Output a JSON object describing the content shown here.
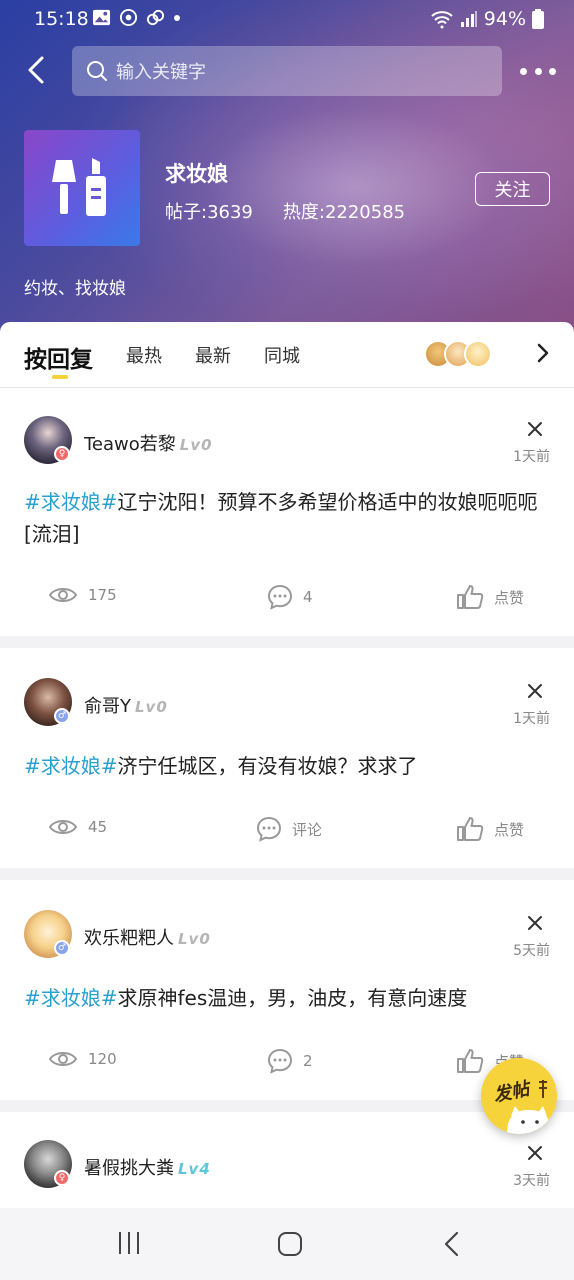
{
  "status_bar": {
    "time": "15:18",
    "battery": "94%"
  },
  "search": {
    "placeholder": "输入关键字"
  },
  "forum": {
    "name": "求妆娘",
    "posts_label": "帖子:3639",
    "heat_label": "热度:2220585",
    "follow_label": "关注",
    "description": "约妆、找妆娘"
  },
  "tabs": [
    {
      "label": "按回复",
      "active": true
    },
    {
      "label": "最热"
    },
    {
      "label": "最新"
    },
    {
      "label": "同城"
    }
  ],
  "posts": [
    {
      "username": "Teawo若黎",
      "level": "Lv0",
      "time": "1天前",
      "hashtag": "#求妆娘#",
      "text": "辽宁沈阳！预算不多希望价格适中的妆娘呃呃呃[流泪]",
      "views": "175",
      "comments": "4",
      "like_label": "点赞",
      "gender": "female"
    },
    {
      "username": "俞哥Y",
      "level": "Lv0",
      "time": "1天前",
      "hashtag": "#求妆娘#",
      "text": "济宁任城区，有没有妆娘？求求了",
      "views": "45",
      "comments": "评论",
      "like_label": "点赞",
      "gender": "male"
    },
    {
      "username": "欢乐粑粑人",
      "level": "Lv0",
      "time": "5天前",
      "hashtag": "#求妆娘#",
      "text": "求原神fes温迪，男，油皮，有意向速度",
      "views": "120",
      "comments": "2",
      "like_label": "点赞",
      "gender": "male"
    },
    {
      "username": "暑假挑大粪",
      "level": "Lv4",
      "time": "3天前",
      "gender": "female"
    }
  ],
  "fab": {
    "label": "发帖"
  },
  "colors": {
    "hashtag": "#2c9fd1",
    "accent": "#f7d33b",
    "level4": "#5ac8d8"
  }
}
